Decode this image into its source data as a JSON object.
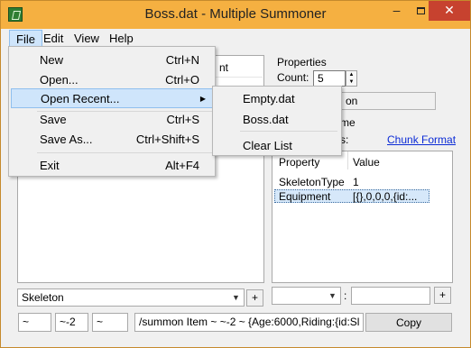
{
  "window": {
    "title": "Boss.dat - Multiple Summoner",
    "buttons": {
      "minimize": "‒",
      "close": "✕"
    }
  },
  "menubar": {
    "file": "File",
    "edit": "Edit",
    "view": "View",
    "help": "Help"
  },
  "file_menu": {
    "items": [
      {
        "label": "New",
        "shortcut": "Ctrl+N"
      },
      {
        "label": "Open...",
        "shortcut": "Ctrl+O"
      },
      {
        "label": "Open Recent...",
        "shortcut": ""
      },
      {
        "label": "Save",
        "shortcut": "Ctrl+S"
      },
      {
        "label": "Save As...",
        "shortcut": "Ctrl+Shift+S"
      },
      {
        "label": "Exit",
        "shortcut": "Alt+F4"
      }
    ]
  },
  "recent_menu": {
    "items": [
      "Empty.dat",
      "Boss.dat",
      "Clear List"
    ]
  },
  "left_panel": {
    "header_partial": "nt"
  },
  "properties": {
    "group_label": "Properties",
    "count_label": "Count:",
    "count_value": "5",
    "name_field_partial": "on",
    "name_label_partial": "me",
    "s_label_partial": "s:",
    "chunk_link": "Chunk Format"
  },
  "property_grid": {
    "headers": [
      "Property",
      "Value"
    ],
    "rows": [
      {
        "property": "SkeletonType",
        "value": "1"
      },
      {
        "property": "Equipment",
        "value": "[{},0,0,0,{id:..."
      }
    ]
  },
  "bottom": {
    "skeleton_selected": "Skeleton",
    "add_label": "+",
    "colon": ":",
    "coord_x": "~",
    "coord_y": "~-2",
    "coord_z": "~",
    "command": "/summon Item ~ ~-2 ~ {Age:6000,Riding:{id:Sl",
    "copy_label": "Copy"
  }
}
